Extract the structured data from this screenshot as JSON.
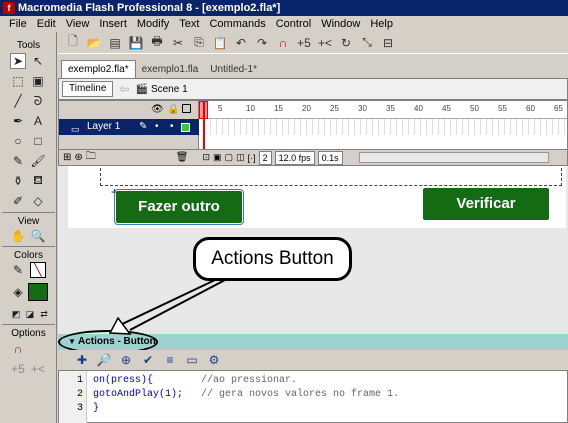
{
  "window": {
    "title": "Macromedia Flash Professional 8 - [exemplo2.fla*]"
  },
  "menu": [
    "File",
    "Edit",
    "View",
    "Insert",
    "Modify",
    "Text",
    "Commands",
    "Control",
    "Window",
    "Help"
  ],
  "tools_panel": {
    "tools_label": "Tools",
    "view_label": "View",
    "colors_label": "Colors",
    "options_label": "Options"
  },
  "doc_tabs": [
    "exemplo2.fla*",
    "exemplo1.fla",
    "Untitled-1*"
  ],
  "timeline": {
    "timeline_button": "Timeline",
    "scene_label": "Scene 1",
    "layer_name": "Layer 1",
    "ruler_ticks": [
      "5",
      "10",
      "15",
      "20",
      "25",
      "30",
      "35",
      "40",
      "45",
      "50",
      "55",
      "60",
      "65"
    ],
    "current_frame": "2",
    "frame_rate": "12.0 fps",
    "elapsed_time": "0.1s"
  },
  "stage": {
    "button1_label": "Fazer outro",
    "button2_label": "Verificar"
  },
  "callout": {
    "text": "Actions Button"
  },
  "actions_panel": {
    "title": "Actions - Button",
    "code_lines": [
      {
        "num": "1",
        "code": "on(press){",
        "comment": "//ao pressionar."
      },
      {
        "num": "2",
        "code": "gotoAndPlay(1);",
        "comment": "// gera novos valores no frame 1."
      },
      {
        "num": "3",
        "code": "}",
        "comment": ""
      }
    ]
  }
}
